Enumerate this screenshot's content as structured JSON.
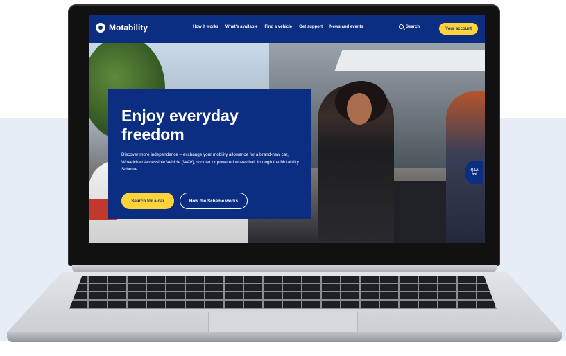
{
  "brand": {
    "name": "Motability",
    "color": "#0b2e82",
    "accent": "#ffd43a"
  },
  "nav": {
    "links": [
      "How it works",
      "What's available",
      "Find a vehicle",
      "Get support",
      "News and events"
    ],
    "search_label": "Search",
    "account_label": "Your account"
  },
  "hero": {
    "title": "Enjoy everyday freedom",
    "body": "Discover more independence – exchange your mobility allowance for a brand-new car, Wheelchair Accessible Vehicle (WAV), scooter or powered wheelchair through the Motability Scheme.",
    "primary_button": "Search for a car",
    "secondary_button": "How the Scheme works"
  },
  "qa_badge": {
    "line1": "Q&A",
    "line2": "bot"
  }
}
